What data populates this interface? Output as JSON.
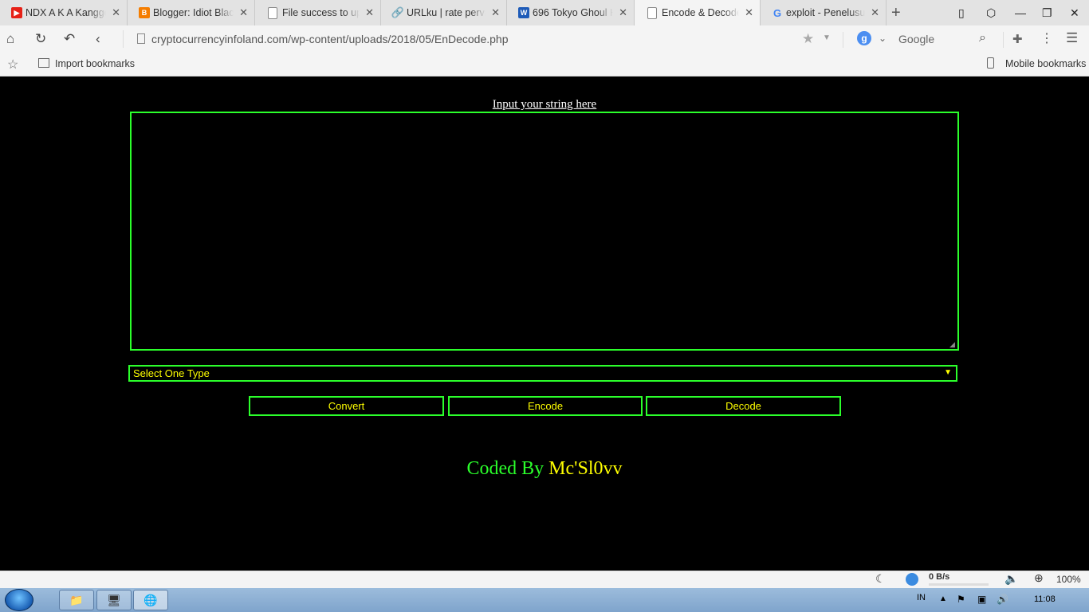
{
  "browser": {
    "tabs": [
      {
        "label": "NDX A K A Kanggo",
        "favicon": "youtube-icon",
        "active": false
      },
      {
        "label": "Blogger: Idiot Black",
        "favicon": "blogger-icon",
        "active": false
      },
      {
        "label": "File success to uplo",
        "favicon": "document-icon",
        "active": false
      },
      {
        "label": "URLku | rate perval",
        "favicon": "link-icon",
        "active": false
      },
      {
        "label": "696 Tokyo Ghoul H",
        "favicon": "w-icon",
        "active": false
      },
      {
        "label": "Encode & Decode",
        "favicon": "document-icon",
        "active": true
      },
      {
        "label": "exploit - Penelusur",
        "favicon": "google-icon",
        "active": false
      }
    ],
    "url": "cryptocurrencyinfoland.com/wp-content/uploads/2018/05/EnDecode.php",
    "search_engine_letter": "g",
    "search_engine_name": "Google",
    "bookmarks": {
      "import_label": "Import bookmarks",
      "mobile_label": "Mobile bookmarks"
    }
  },
  "page": {
    "input_title": "Input your string here",
    "textarea_value": "",
    "select_value": "Select One Type",
    "buttons": {
      "convert": "Convert",
      "encode": "Encode",
      "decode": "Decode"
    },
    "credit_prefix": "Coded By",
    "credit_name": "Mc'Sl0vv",
    "colors": {
      "background": "#000000",
      "border": "#2bff2b",
      "button_text": "#ffff00",
      "title_text": "#ffffff"
    }
  },
  "statusbar": {
    "speed": "0 B/s",
    "zoom": "100%"
  },
  "taskbar": {
    "language": "IN",
    "clock": "11:08"
  }
}
